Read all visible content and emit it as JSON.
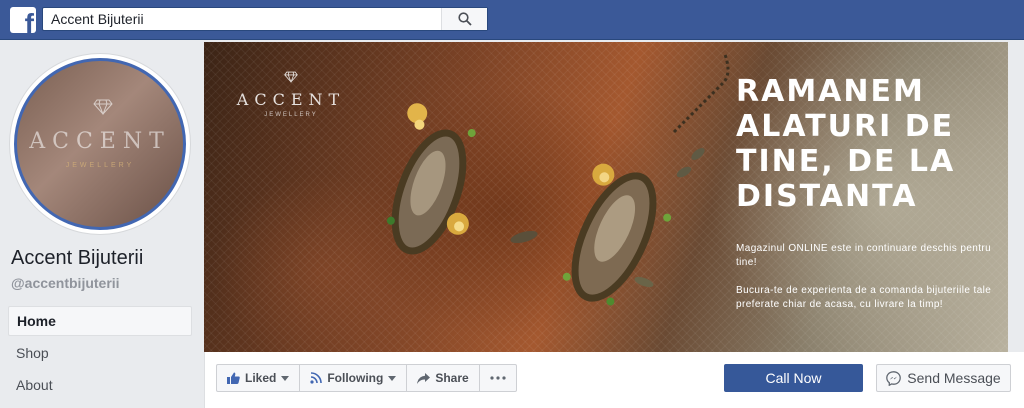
{
  "topbar": {
    "search_value": "Accent Bijuterii",
    "logo_icon": "facebook-logo-icon",
    "search_icon": "search-icon",
    "bg_color": "#3b5998"
  },
  "profile": {
    "avatar_brand": "ACCENT",
    "avatar_sub": "JEWELLERY",
    "page_name": "Accent Bijuterii",
    "page_handle": "@accentbijuterii"
  },
  "nav": {
    "items": [
      {
        "label": "Home",
        "active": true
      },
      {
        "label": "Shop",
        "active": false
      },
      {
        "label": "About",
        "active": false
      }
    ]
  },
  "cover": {
    "brand": "ACCENT",
    "brand_sub": "JEWELLERY",
    "headline": "RAMANEM ALATURI DE TINE, DE LA DISTANTA",
    "body_1": "Magazinul ONLINE este in continuare deschis pentru tine!",
    "body_2": "Bucura-te de experienta de a comanda bijuteriile tale preferate chiar de acasa, cu livrare la timp!"
  },
  "actions": {
    "liked_label": "Liked",
    "following_label": "Following",
    "share_label": "Share",
    "more_icon": "more-dots-icon",
    "call_label": "Call Now",
    "message_label": "Send Message",
    "accent_color": "#365899"
  }
}
